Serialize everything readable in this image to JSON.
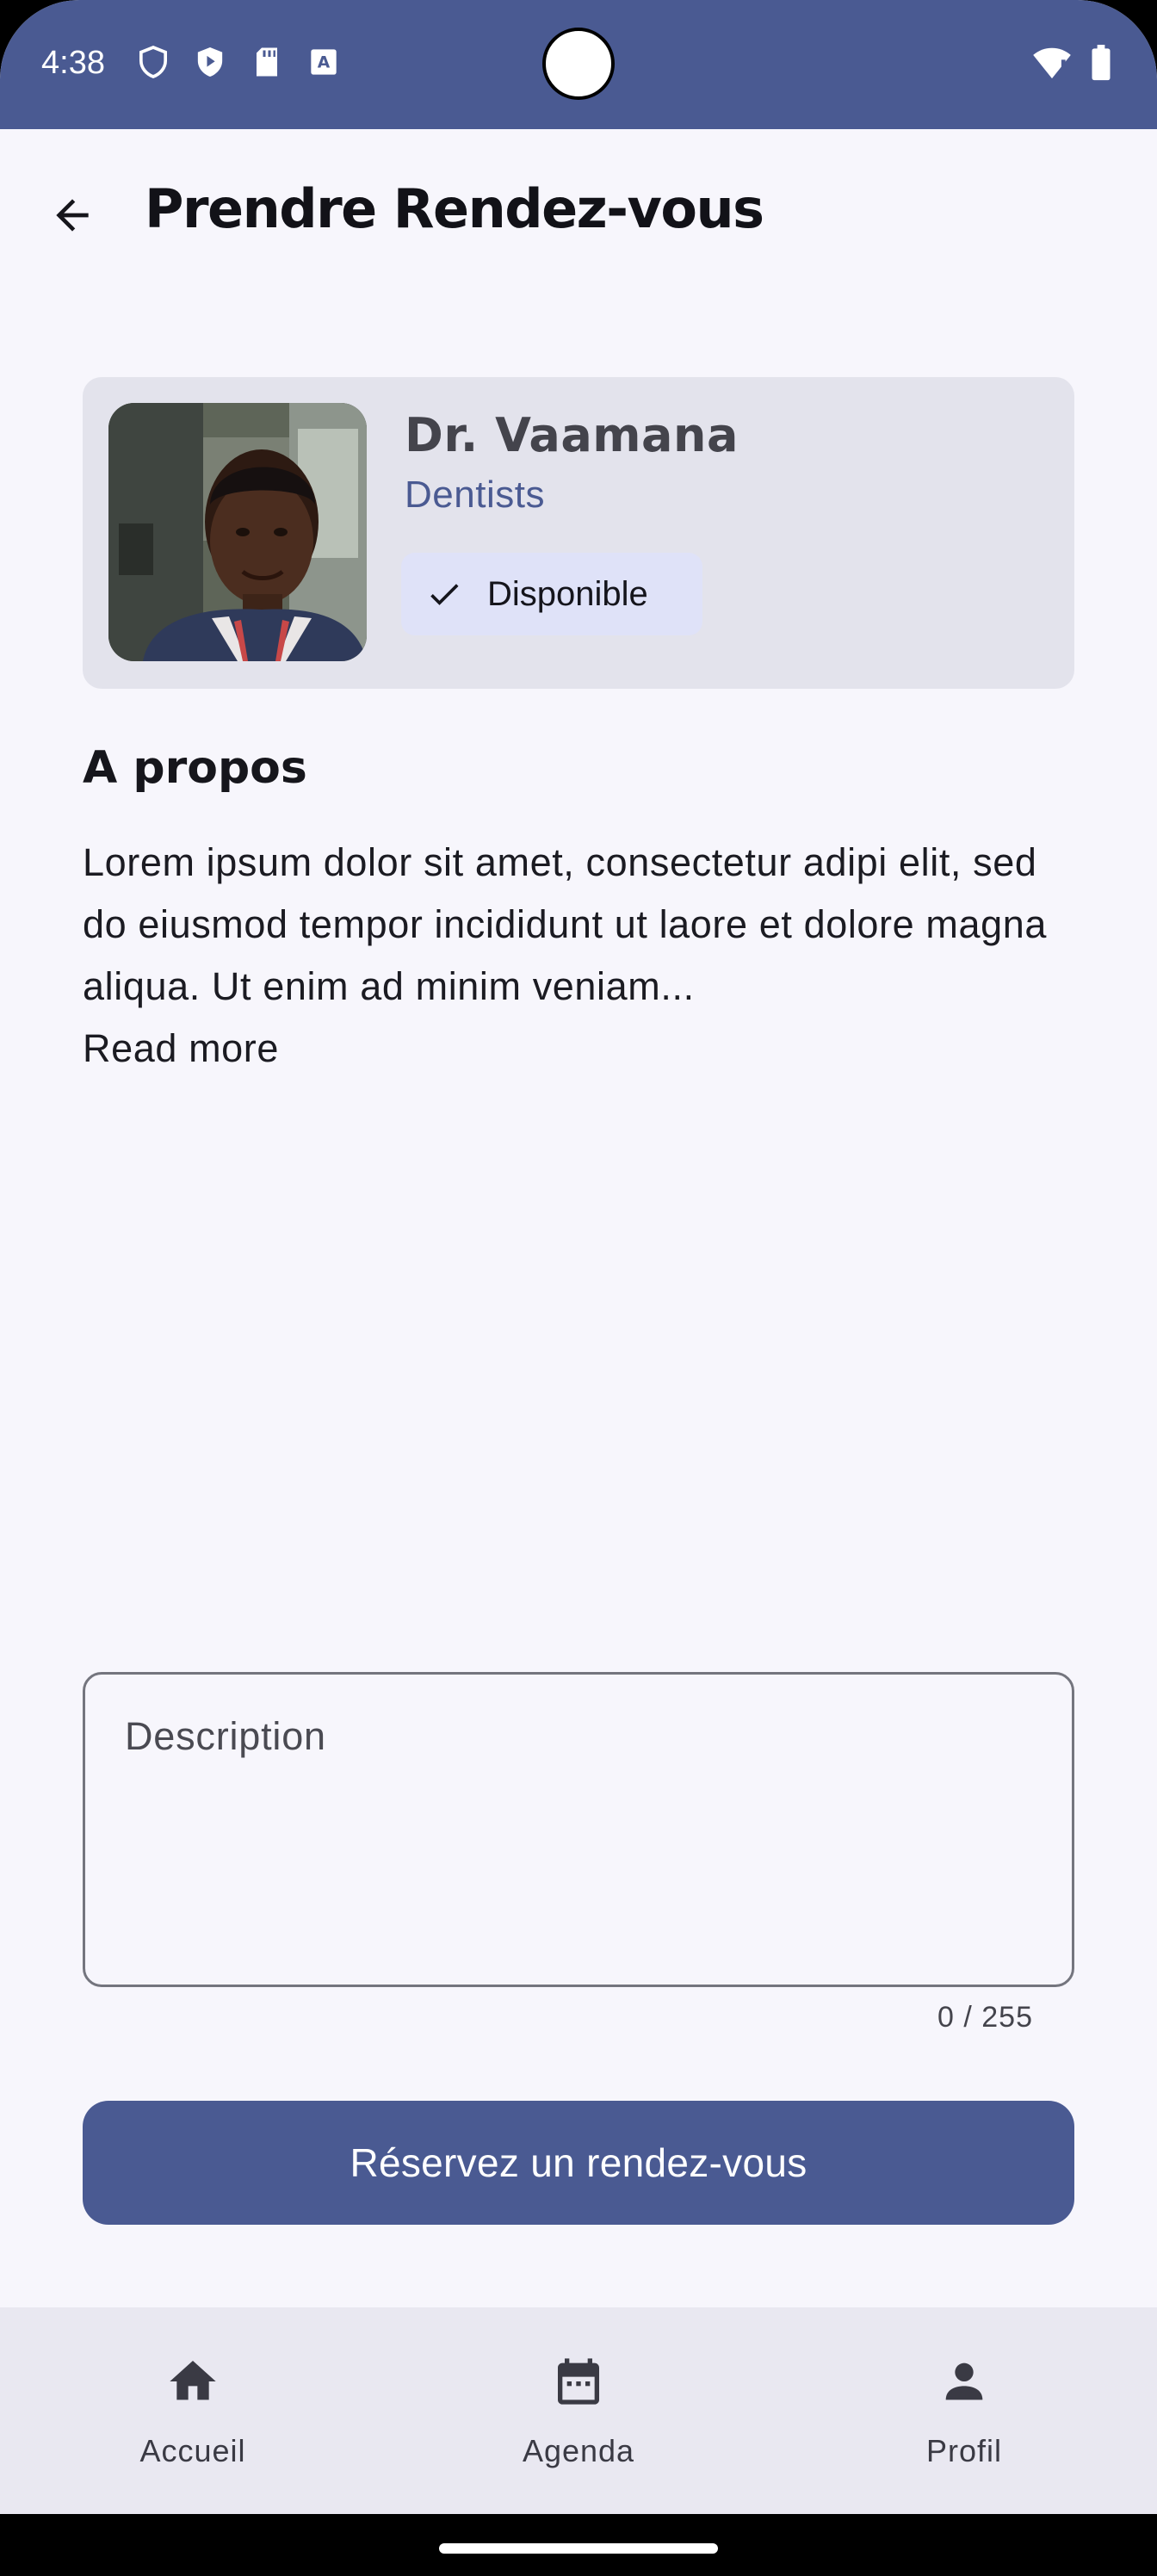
{
  "status_bar": {
    "time": "4:38",
    "left_icons": [
      "shield-icon",
      "play-protect-icon",
      "sd-card-icon",
      "keyboard-a-icon"
    ],
    "right_icons": [
      "wifi-alert-icon",
      "battery-icon"
    ]
  },
  "app_bar": {
    "title": "Prendre Rendez-vous",
    "back_icon": "arrow-back-icon"
  },
  "doctor": {
    "name": "Dr. Vaamana",
    "specialty": "Dentists",
    "availability": "Disponible"
  },
  "about": {
    "heading": "A propos",
    "text": "Lorem ipsum dolor sit amet, consectetur adipi elit, sed do eiusmod tempor incididunt ut laore et dolore magna aliqua. Ut enim ad minim veniam...",
    "read_more": "Read more"
  },
  "description_field": {
    "placeholder": "Description",
    "value": "",
    "counter": "0 / 255"
  },
  "book_button": {
    "label": "Réservez un rendez-vous"
  },
  "bottom_nav": {
    "items": [
      {
        "label": "Accueil",
        "icon": "home-icon"
      },
      {
        "label": "Agenda",
        "icon": "calendar-icon"
      },
      {
        "label": "Profil",
        "icon": "person-icon"
      }
    ]
  },
  "colors": {
    "primary": "#4a5a92",
    "background": "#f7f6fc",
    "card": "#e3e3ec",
    "chip": "#dfe2f8",
    "nav": "#e9e8f1"
  }
}
